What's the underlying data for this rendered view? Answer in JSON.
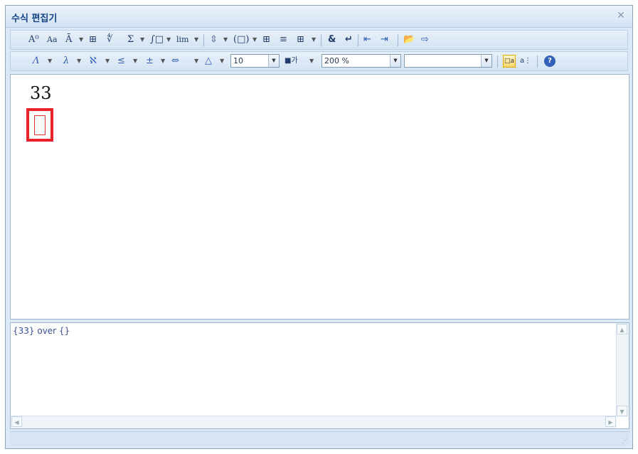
{
  "window": {
    "title": "수식 편집기",
    "close_glyph": "✕"
  },
  "toolbar1": {
    "items": [
      "A⁰",
      "Aa",
      "Ā",
      "⊞",
      "∜",
      "Σ",
      "∫□",
      "lim",
      "⇳",
      "(□)",
      "⊞",
      "≡",
      "⊞",
      "&",
      "↵",
      "⇤",
      "⇥",
      "📂",
      "⇨"
    ]
  },
  "toolbar2": {
    "items": [
      "Λ",
      "λ",
      "ℵ",
      "≤",
      "±",
      "⇔",
      "△"
    ],
    "font_size": "10",
    "color_glyph": "■가",
    "zoom": "200 %",
    "font_name": "",
    "help_glyph": "?"
  },
  "editor": {
    "numerator": "33"
  },
  "source": {
    "text": "{33} over {}"
  },
  "colors": {
    "caret_border": "#e8232b",
    "title_text": "#15428b"
  }
}
